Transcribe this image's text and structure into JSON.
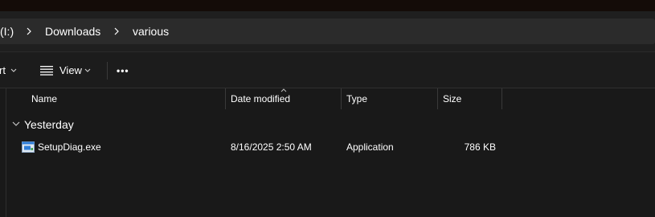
{
  "breadcrumb": {
    "drive_label": "(I:)",
    "items": [
      "Downloads",
      "various"
    ]
  },
  "toolbar": {
    "sort_label": "rt",
    "view_label": "View",
    "more_label": "•••"
  },
  "columns": [
    "Name",
    "Date modified",
    "Type",
    "Size"
  ],
  "groups": [
    {
      "label": "Yesterday",
      "files": [
        {
          "name": "SetupDiag.exe",
          "date_modified": "8/16/2025 2:50 AM",
          "type": "Application",
          "size": "786 KB",
          "icon": "application-exe-icon"
        }
      ]
    }
  ],
  "colors": {
    "background": "#191919",
    "address_bar": "#2b2b2b",
    "text": "#ffffff",
    "icon_blue": "#2f7ed8"
  }
}
